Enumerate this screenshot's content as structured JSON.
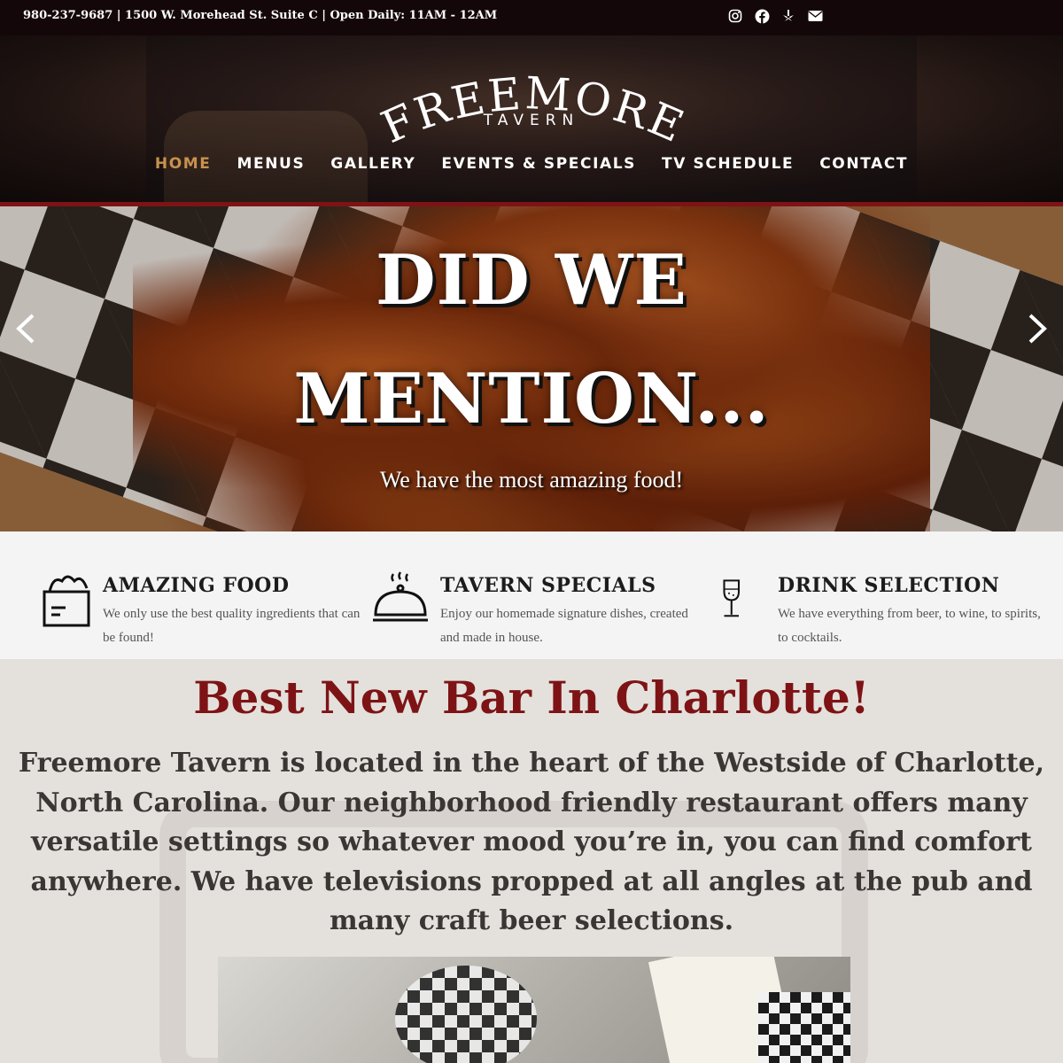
{
  "topbar": {
    "info": "980-237-9687 |  1500 W. Morehead St. Suite C | Open Daily: 11AM - 12AM",
    "social": [
      "instagram-icon",
      "facebook-icon",
      "yelp-icon",
      "email-icon"
    ]
  },
  "logo": {
    "name": "FREEMORE",
    "sub": "TAVERN"
  },
  "nav": [
    {
      "label": "HOME",
      "active": true
    },
    {
      "label": "MENUS"
    },
    {
      "label": "GALLERY"
    },
    {
      "label": "EVENTS & SPECIALS"
    },
    {
      "label": "TV SCHEDULE"
    },
    {
      "label": "CONTACT"
    }
  ],
  "hero": {
    "line1": "DID WE",
    "line2": "MENTION...",
    "subtitle": "We have the most amazing food!"
  },
  "features": [
    {
      "icon": "grocery-bag-icon",
      "title": "AMAZING FOOD",
      "text": "We only use the best quality ingredients that can be found!"
    },
    {
      "icon": "cloche-icon",
      "title": "TAVERN SPECIALS",
      "text": "Enjoy our homemade signature dishes, created and made in house."
    },
    {
      "icon": "wine-glass-icon",
      "title": "DRINK SELECTION",
      "text": "We have everything from beer, to wine, to spirits, to cocktails."
    }
  ],
  "about": {
    "heading": "Best New Bar In Charlotte!",
    "body": "Freemore Tavern is located in the heart of the Westside of Charlotte, North Carolina. Our neighborhood friendly restaurant offers many versatile settings so whatever mood you’re in, you can find comfort anywhere. We have televisions propped at all angles at the pub and many craft beer selections."
  },
  "colors": {
    "accent": "#c8914e",
    "brand_red": "#7e1316",
    "topbar": "#140709"
  }
}
